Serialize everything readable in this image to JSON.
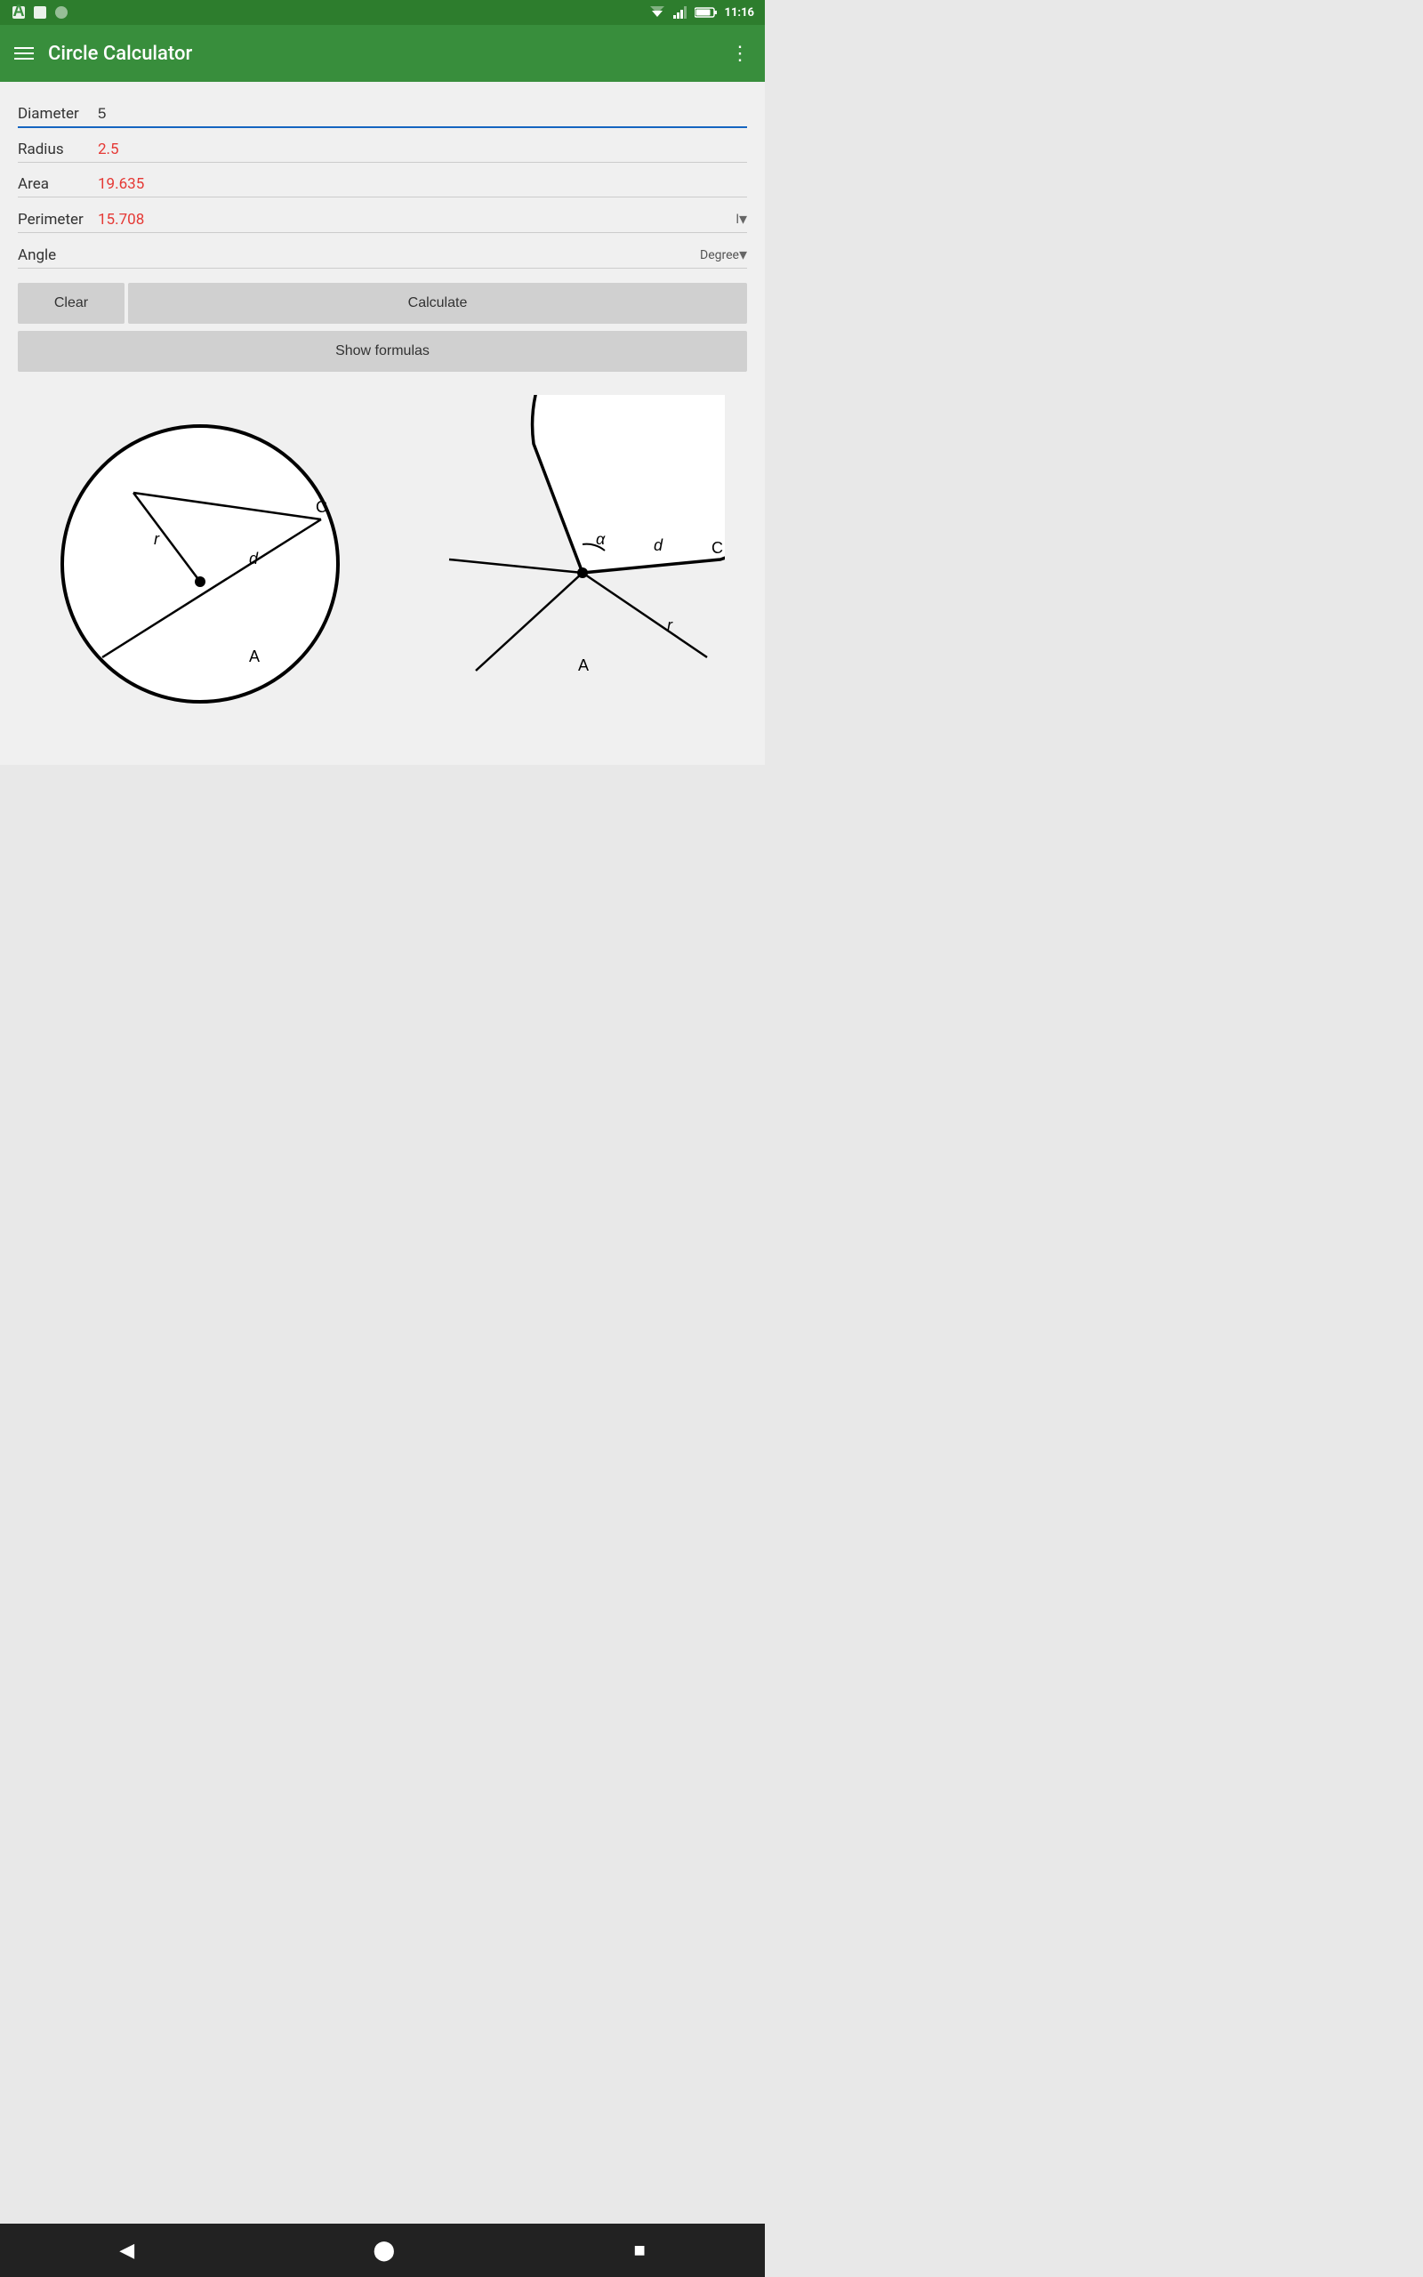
{
  "statusBar": {
    "time": "11:16"
  },
  "appBar": {
    "title": "Circle Calculator",
    "menuLabel": "menu",
    "moreLabel": "more options"
  },
  "fields": {
    "diameter": {
      "label": "Diameter",
      "value": "5"
    },
    "radius": {
      "label": "Radius",
      "value": "2.5"
    },
    "area": {
      "label": "Area",
      "value": "19.635"
    },
    "perimeter": {
      "label": "Perimeter",
      "value": "15.708",
      "unit": "l"
    },
    "angle": {
      "label": "Angle",
      "value": "",
      "unit": "Degree",
      "placeholder": ""
    }
  },
  "buttons": {
    "clear": "Clear",
    "calculate": "Calculate",
    "showFormulas": "Show formulas"
  },
  "navBar": {
    "back": "◀",
    "home": "⬤",
    "recent": "■"
  },
  "diagram": {
    "left": {
      "labels": [
        "r",
        "C",
        "d",
        "A"
      ]
    },
    "right": {
      "labels": [
        "α",
        "C",
        "d",
        "r",
        "A"
      ]
    }
  }
}
